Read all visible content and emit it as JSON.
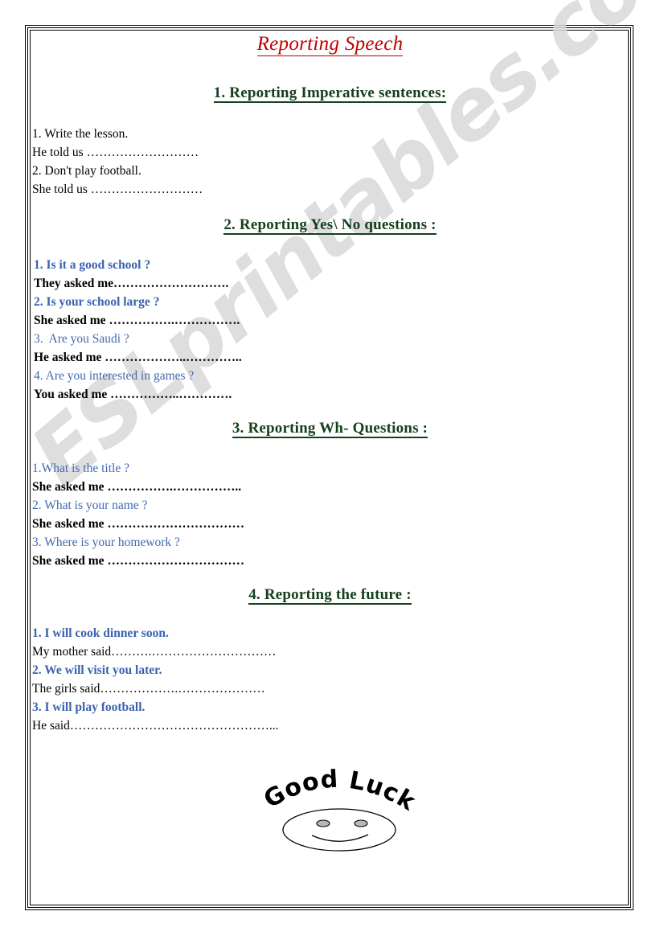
{
  "document": {
    "title": "Reporting Speech",
    "watermark": "ESLprintables.com"
  },
  "sections": [
    {
      "heading": "1. Reporting Imperative sentences:",
      "lines": [
        {
          "text": "1. Write the lesson.",
          "style": "black"
        },
        {
          "text": "He told us ………………………",
          "style": "black"
        },
        {
          "text": "2. Don't play football.",
          "style": "black"
        },
        {
          "text": "She told us ………………………",
          "style": "black"
        }
      ]
    },
    {
      "heading": "2. Reporting Yes\\ No questions :",
      "lines": [
        {
          "text": "1. Is it a good school ?",
          "style": "blue-bold"
        },
        {
          "text": "They asked me……………………….",
          "style": "black-bold"
        },
        {
          "text": "2. Is your school large ?",
          "style": "blue-bold"
        },
        {
          "text": "She asked me …………….…………….",
          "style": "black-bold"
        },
        {
          "text": "3.  Are you Saudi ?",
          "style": "blue"
        },
        {
          "text": "He asked me ………………..…………..",
          "style": "black-bold"
        },
        {
          "text": "4. Are you interested in games ?",
          "style": "blue"
        },
        {
          "text": "You asked me ……………..………….",
          "style": "black-bold"
        }
      ]
    },
    {
      "heading": "3. Reporting Wh- Questions :",
      "lines": [
        {
          "text": "1.What is the title ?",
          "style": "blue"
        },
        {
          "text": "She asked me …………….……………..",
          "style": "black-bold"
        },
        {
          "text": "2. What is your name ?",
          "style": "blue"
        },
        {
          "text": "She asked me ……………………………",
          "style": "black-bold"
        },
        {
          "text": "3. Where is your homework ?",
          "style": "blue"
        },
        {
          "text": "She asked me ……………………………",
          "style": "black-bold"
        }
      ]
    },
    {
      "heading": "4. Reporting the future :",
      "lines": [
        {
          "text": "1. I will cook dinner soon.",
          "style": "blue-bold"
        },
        {
          "text": "My mother said……….…………………………",
          "style": "black"
        },
        {
          "text": "2. We will visit you later.",
          "style": "blue-bold"
        },
        {
          "text": "The girls said……………….…………………",
          "style": "black"
        },
        {
          "text": "3. I will play football.",
          "style": "blue-bold"
        },
        {
          "text": "He said…………………………………………...",
          "style": "black"
        }
      ]
    }
  ],
  "footer": {
    "good_luck_text": "Good Luck",
    "smiley": "smiley-face"
  },
  "colors": {
    "title": "#c00000",
    "heading": "#14401c",
    "blue": "#4169b0",
    "body": "#000000",
    "watermark": "#d9d9d9"
  }
}
